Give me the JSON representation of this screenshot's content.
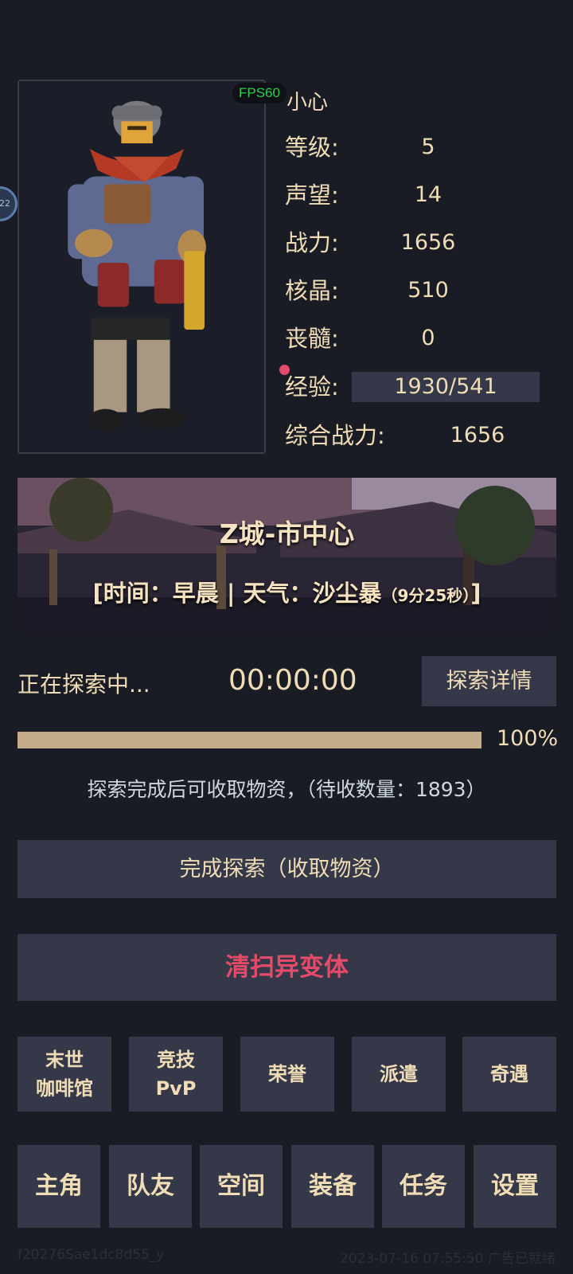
{
  "player": {
    "name": "小心",
    "fps": "FPS60",
    "side_bubble": "22"
  },
  "stats": [
    {
      "label": "等级:",
      "value": "5"
    },
    {
      "label": "声望:",
      "value": "14"
    },
    {
      "label": "战力:",
      "value": "1656"
    },
    {
      "label": "核晶:",
      "value": "510"
    },
    {
      "label": "丧髓:",
      "value": "0"
    }
  ],
  "experience": {
    "label": "经验:",
    "value": "1930/541"
  },
  "combined_power": {
    "label": "综合战力:",
    "value": "1656"
  },
  "location": {
    "title": "Z城-市中心",
    "time_weather_prefix": "[时间：早晨 | 天气：沙尘暴",
    "remaining": "（9分25秒）",
    "suffix": "]"
  },
  "explore": {
    "status": "正在探索中...",
    "timer": "00:00:00",
    "detail_button": "探索详情",
    "progress": 1.0,
    "progress_label": "100%",
    "collect_info": "探索完成后可收取物资，（待收数量：1893）",
    "finish_button": "完成探索（收取物资）",
    "clear_button": "清扫异变体"
  },
  "features": [
    {
      "line1": "末世",
      "line2": "咖啡馆"
    },
    {
      "line1": "竞技",
      "line2": "PvP"
    },
    {
      "line1": "荣誉",
      "line2": ""
    },
    {
      "line1": "派遣",
      "line2": ""
    },
    {
      "line1": "奇遇",
      "line2": ""
    }
  ],
  "nav": [
    "主角",
    "队友",
    "空间",
    "装备",
    "任务",
    "设置"
  ],
  "footer": {
    "left": "f20276Sae1dc8d55_y",
    "right": "2023-07-16 07:55:50 广告已就绪"
  },
  "colors": {
    "background": "#191c25",
    "panel": "#343848",
    "text": "#f0dcb5",
    "accent_red": "#e44b69",
    "fps_green": "#27d14f",
    "progress": "#c5ad8c"
  }
}
